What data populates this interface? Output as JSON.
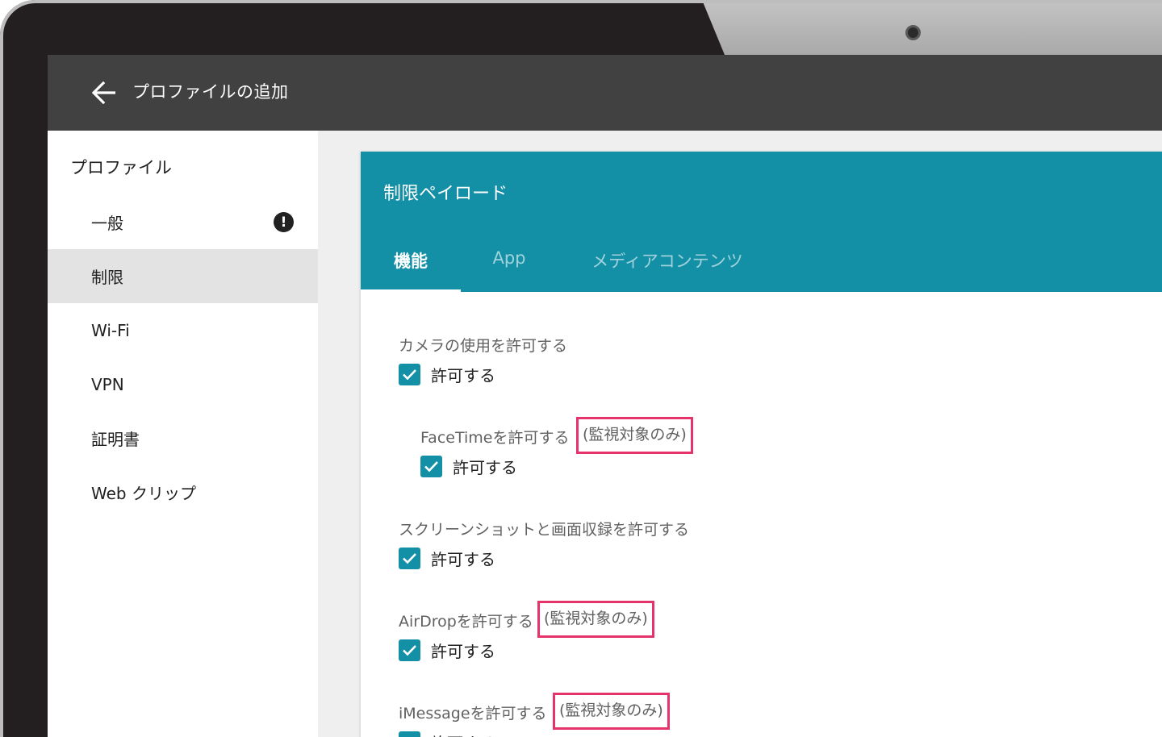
{
  "app_bar": {
    "title": "プロファイルの追加",
    "back_icon": "arrow-left-icon"
  },
  "sidebar": {
    "heading": "プロファイル",
    "items": [
      {
        "label": "一般",
        "alert": "!"
      },
      {
        "label": "制限",
        "active": true
      },
      {
        "label": "Wi-Fi"
      },
      {
        "label": "VPN"
      },
      {
        "label": "証明書"
      },
      {
        "label": "Web クリップ"
      }
    ]
  },
  "card": {
    "title": "制限ペイロード",
    "tabs": [
      {
        "label": "機能",
        "selected": true
      },
      {
        "label": "App"
      },
      {
        "label": "メディアコンテンツ"
      }
    ],
    "settings": [
      {
        "label": "カメラの使用を許可する",
        "checkbox_label": "許可する",
        "checked": true
      },
      {
        "label": "FaceTimeを許可する",
        "badge": "(監視対象のみ)",
        "checkbox_label": "許可する",
        "checked": true
      },
      {
        "label": "スクリーンショットと画面収録を許可する",
        "checkbox_label": "許可する",
        "checked": true
      },
      {
        "label": "AirDropを許可する",
        "badge": "(監視対象のみ)",
        "checkbox_label": "許可する",
        "checked": true
      },
      {
        "label": "iMessageを許可する",
        "badge": "(監視対象のみ)",
        "checkbox_label": "許可する",
        "checked": true
      }
    ]
  },
  "colors": {
    "accent": "#138fa6",
    "app_bar": "#414141",
    "highlight": "#e6336b",
    "active_row": "#e3e3e3"
  }
}
